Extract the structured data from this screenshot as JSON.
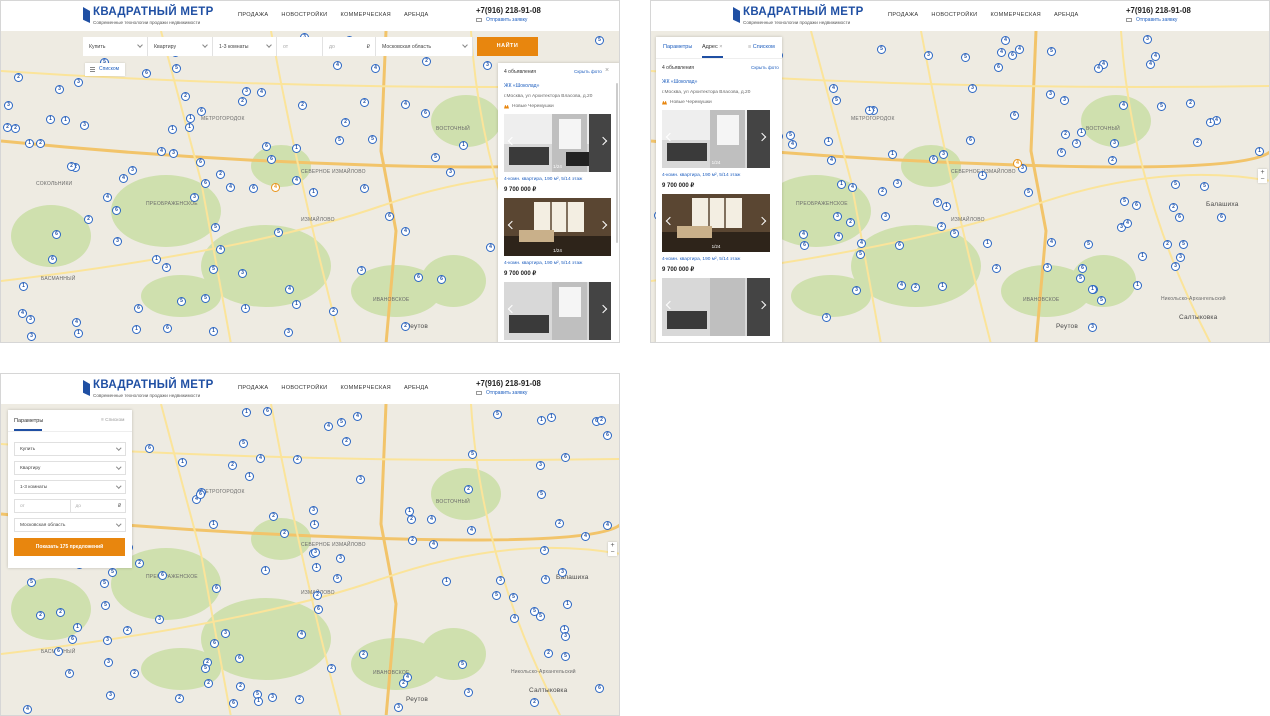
{
  "header": {
    "logo_name": "КВАДРАТНЫЙ МЕТР",
    "logo_tagline": "Современные технологии продажи недвижимости",
    "nav": [
      "ПРОДАЖА",
      "НОВОСТРОЙКИ",
      "КОММЕРЧЕСКАЯ",
      "АРЕНДА"
    ],
    "phone": "+7(916) 218-91-08",
    "request_link": "Отправить заявку"
  },
  "filters": {
    "deal": "Купить",
    "type": "Квартиру",
    "rooms": "1-3 комнаты",
    "price_from_placeholder": "от",
    "price_to_placeholder": "до",
    "currency": "₽",
    "region": "Московская область",
    "find_button": "НАЙТИ",
    "list_toggle": "Списком"
  },
  "panel": {
    "count": "4 объявления",
    "hide_photo": "Скрыть фото",
    "title": "ЖК «Шоколад»",
    "address": "г.Москва, ул Архитектора Власова, д.20",
    "metro": "Новые Черемушки",
    "listings": [
      {
        "desc": "4-комн. квартира, 190 м², 5/14 этаж",
        "price": "9 700 000 ₽",
        "counter": "1/24"
      },
      {
        "desc": "4-комн. квартира, 190 м², 5/14 этаж",
        "price": "9 700 000 ₽",
        "counter": "1/24"
      },
      {
        "desc": "",
        "price": "",
        "counter": ""
      }
    ]
  },
  "tabs": {
    "params": "Параметры",
    "address": "Адрес",
    "list": "Списком"
  },
  "params_panel": {
    "title": "Параметры",
    "list_toggle": "Списком",
    "show_button": "Показать 175 предложений"
  },
  "map_labels": {
    "metrogorodok": "МЕТРОГОРОДОК",
    "vostochny": "ВОСТОЧНЫЙ",
    "sokolniki": "СОКОЛЬНИКИ",
    "severnoe_izm": "СЕВЕРНОЕ ИЗМАЙЛОВО",
    "izmaylovo": "ИЗМАЙЛОВО",
    "preobrazhenskoe": "ПРЕОБРАЖЕНСКОЕ",
    "ivanovskoe": "ИВАНОВСКОЕ",
    "basmanny": "БАСМАННЫЙ",
    "reutov": "Реутов",
    "balashikha": "Балашиха",
    "saltykovka": "Салтыковка",
    "nikolsko": "Никольско-Архангельский"
  },
  "colors": {
    "brand": "#1f4fa3",
    "accent": "#e8860e",
    "link": "#1f5fbf"
  },
  "icons": [
    "logo-mark-icon",
    "envelope-icon",
    "chevron-down-icon",
    "list-icon",
    "close-icon",
    "metro-icon",
    "arrow-left-icon",
    "arrow-right-icon",
    "map-pin-icon",
    "zoom-in-icon",
    "zoom-out-icon"
  ]
}
